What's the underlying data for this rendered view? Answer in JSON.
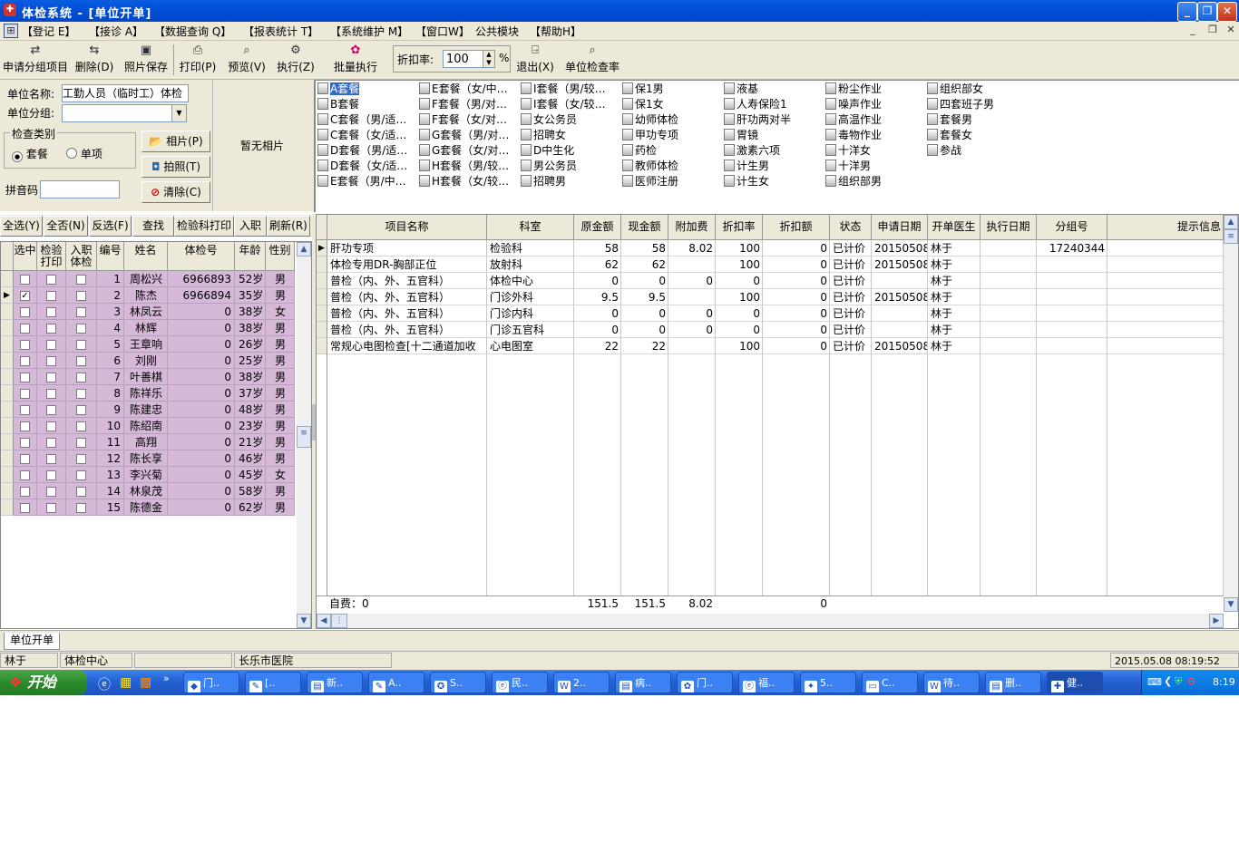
{
  "window": {
    "title": "体检系统 - [单位开单]"
  },
  "menu": [
    "【登记 E】",
    "【接诊 A】",
    "【数据查询 Q】",
    "【报表统计 T】",
    "【系统维护 M】",
    "【窗口W】",
    "公共模块",
    "【帮助H】"
  ],
  "toolbar": {
    "buttons": [
      "申请分组项目",
      "删除(D)",
      "照片保存",
      "打印(P)",
      "预览(V)",
      "执行(Z)",
      "批量执行",
      "退出(X)",
      "单位检查率"
    ],
    "discount_label": "折扣率:",
    "discount_value": "100",
    "discount_unit": "%"
  },
  "info": {
    "unit_name_label": "单位名称:",
    "unit_name_value": "工勤人员（临时工）体检",
    "unit_group_label": "单位分组:",
    "unit_group_value": "",
    "check_type_label": "检查类别",
    "radio_package": "套餐",
    "radio_single": "单项",
    "pinyin_label": "拼音码",
    "pinyin_value": "",
    "photo_btn": "相片(P)",
    "capture_btn": "拍照(T)",
    "clear_btn": "清除(C)",
    "no_photo": "暂无相片"
  },
  "packages": [
    [
      "A套餐",
      "B套餐",
      "C套餐（男/适…",
      "C套餐（女/适…",
      "D套餐（男/适…",
      "D套餐（女/适…",
      "E套餐（男/中…"
    ],
    [
      "E套餐（女/中…",
      "F套餐（男/对…",
      "F套餐（女/对…",
      "G套餐（男/对…",
      "G套餐（女/对…",
      "H套餐（男/较…",
      "H套餐（女/较…"
    ],
    [
      "I套餐（男/较…",
      "I套餐（女/较…",
      "女公务员",
      "招聘女",
      "D中生化",
      "男公务员",
      "招聘男"
    ],
    [
      "保1男",
      "保1女",
      "幼师体检",
      "甲功专项",
      "药检",
      "教师体检",
      "医师注册"
    ],
    [
      "液基",
      "人寿保险1",
      "肝功两对半",
      "胃镜",
      "激素六项",
      "计生男",
      "计生女"
    ],
    [
      "粉尘作业",
      "噪声作业",
      "高温作业",
      "毒物作业",
      "十洋女",
      "十洋男",
      "组织部男"
    ],
    [
      "组织部女",
      "四套班子男",
      "套餐男",
      "套餐女",
      "参战"
    ]
  ],
  "left_actions": [
    "全选(Y)",
    "全否(N)",
    "反选(F)",
    "查找",
    "检验科打印",
    "入职",
    "刷新(R)"
  ],
  "person_headers": [
    "选中",
    "检验打印",
    "入职体检",
    "编号",
    "姓名",
    "体检号",
    "年龄",
    "性别"
  ],
  "persons": [
    {
      "selected": false,
      "no": "1",
      "name": "周松兴",
      "exam_no": "6966893",
      "age": "52岁",
      "sex": "男"
    },
    {
      "selected": true,
      "no": "2",
      "name": "陈杰",
      "exam_no": "6966894",
      "age": "35岁",
      "sex": "男"
    },
    {
      "selected": false,
      "no": "3",
      "name": "林凤云",
      "exam_no": "0",
      "age": "38岁",
      "sex": "女"
    },
    {
      "selected": false,
      "no": "4",
      "name": "林辉",
      "exam_no": "0",
      "age": "38岁",
      "sex": "男"
    },
    {
      "selected": false,
      "no": "5",
      "name": "王章响",
      "exam_no": "0",
      "age": "26岁",
      "sex": "男"
    },
    {
      "selected": false,
      "no": "6",
      "name": "刘刚",
      "exam_no": "0",
      "age": "25岁",
      "sex": "男"
    },
    {
      "selected": false,
      "no": "7",
      "name": "叶善棋",
      "exam_no": "0",
      "age": "38岁",
      "sex": "男"
    },
    {
      "selected": false,
      "no": "8",
      "name": "陈祥乐",
      "exam_no": "0",
      "age": "37岁",
      "sex": "男"
    },
    {
      "selected": false,
      "no": "9",
      "name": "陈建忠",
      "exam_no": "0",
      "age": "48岁",
      "sex": "男"
    },
    {
      "selected": false,
      "no": "10",
      "name": "陈绍南",
      "exam_no": "0",
      "age": "23岁",
      "sex": "男"
    },
    {
      "selected": false,
      "no": "11",
      "name": "高翔",
      "exam_no": "0",
      "age": "21岁",
      "sex": "男"
    },
    {
      "selected": false,
      "no": "12",
      "name": "陈长享",
      "exam_no": "0",
      "age": "46岁",
      "sex": "男"
    },
    {
      "selected": false,
      "no": "13",
      "name": "李兴菊",
      "exam_no": "0",
      "age": "45岁",
      "sex": "女"
    },
    {
      "selected": false,
      "no": "14",
      "name": "林泉茂",
      "exam_no": "0",
      "age": "58岁",
      "sex": "男"
    },
    {
      "selected": false,
      "no": "15",
      "name": "陈德金",
      "exam_no": "0",
      "age": "62岁",
      "sex": "男"
    }
  ],
  "item_headers": [
    "项目名称",
    "科室",
    "原金额",
    "现金额",
    "附加费",
    "折扣率",
    "折扣额",
    "状态",
    "申请日期",
    "开单医生",
    "执行日期",
    "分组号",
    "提示信息"
  ],
  "items": [
    [
      "肝功专项",
      "检验科",
      "58",
      "58",
      "8.02",
      "100",
      "0",
      "已计价",
      "20150508",
      "林于",
      "",
      "17240344",
      ""
    ],
    [
      "体检专用DR-胸部正位",
      "放射科",
      "62",
      "62",
      "",
      "100",
      "0",
      "已计价",
      "20150508",
      "林于",
      "",
      "",
      ""
    ],
    [
      "普检（内、外、五官科）",
      "体检中心",
      "0",
      "0",
      "0",
      "0",
      "0",
      "已计价",
      "",
      "林于",
      "",
      "",
      ""
    ],
    [
      "普检（内、外、五官科）",
      "门诊外科",
      "9.5",
      "9.5",
      "",
      "100",
      "0",
      "已计价",
      "20150508",
      "林于",
      "",
      "",
      ""
    ],
    [
      "普检（内、外、五官科）",
      "门诊内科",
      "0",
      "0",
      "0",
      "0",
      "0",
      "已计价",
      "",
      "林于",
      "",
      "",
      ""
    ],
    [
      "普检（内、外、五官科）",
      "门诊五官科",
      "0",
      "0",
      "0",
      "0",
      "0",
      "已计价",
      "",
      "林于",
      "",
      "",
      ""
    ],
    [
      "常规心电图检查[十二通道加收",
      "心电图室",
      "22",
      "22",
      "",
      "100",
      "0",
      "已计价",
      "20150508",
      "林于",
      "",
      "",
      ""
    ]
  ],
  "totals": {
    "label": "自费：0",
    "orig": "151.5",
    "now": "151.5",
    "extra": "8.02",
    "disc_amt": "0"
  },
  "tab": "单位开单",
  "status": {
    "user": "林于",
    "dept": "体检中心",
    "hospital": "长乐市医院",
    "datetime": "2015.05.08 08:19:52"
  },
  "taskbar": {
    "start": "开始",
    "tasks": [
      "门..",
      "[..",
      "新..",
      "A..",
      "S..",
      "民..",
      "2..",
      "病..",
      "门..",
      "福..",
      "5..",
      "C..",
      "待..",
      "删..",
      "健.."
    ],
    "clock": "8:19"
  },
  "colors": {
    "titlebar": "#0050d8",
    "row_highlight": "#d6b8d8",
    "selection": "#316ac5"
  }
}
